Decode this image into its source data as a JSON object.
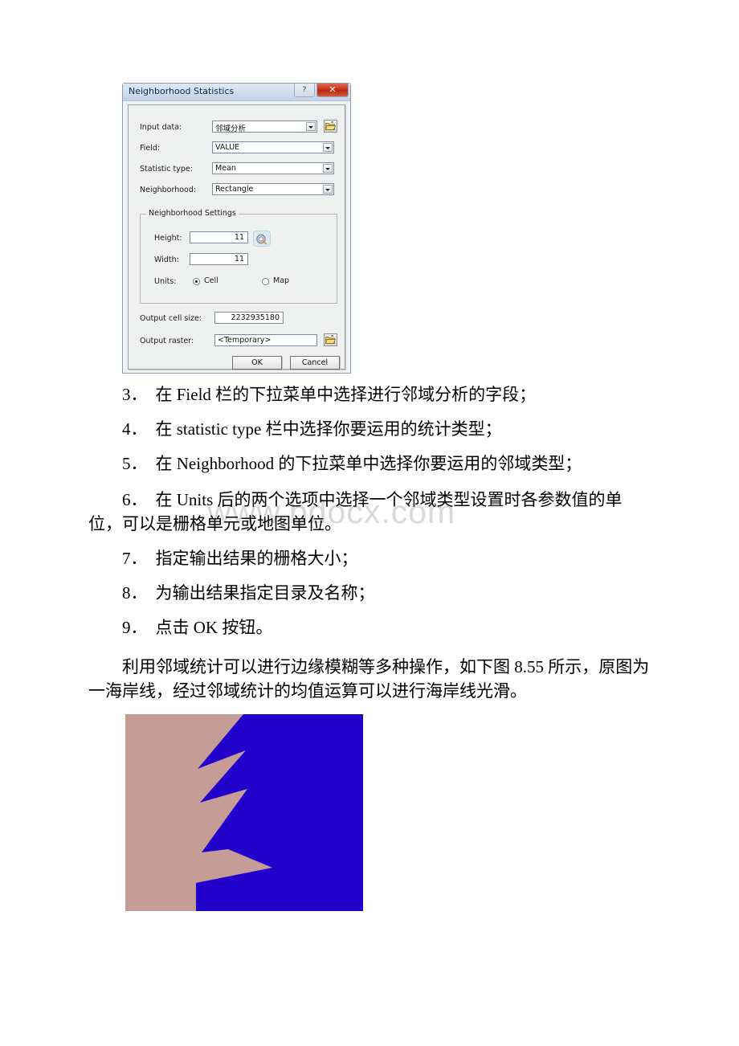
{
  "document": {
    "page_background": "#ffffff",
    "watermark": "www.bdocx.com",
    "watermark_color": "#d9d9d9"
  },
  "dialog": {
    "title": "Neighborhood Statistics",
    "help_button": "?",
    "close_button": "✕",
    "close_button_color": "#c8331b",
    "fields": [
      {
        "label": "Input data:",
        "value": "邻域分析",
        "type": "combobox",
        "has_browse": true
      },
      {
        "label": "Field:",
        "value": "VALUE",
        "type": "combobox",
        "has_browse": false
      },
      {
        "label": "Statistic type:",
        "value": "Mean",
        "type": "combobox",
        "has_browse": false
      },
      {
        "label": "Neighborhood:",
        "value": "Rectangle",
        "type": "combobox",
        "has_browse": false
      }
    ],
    "group": {
      "title": "Neighborhood Settings",
      "height_label": "Height:",
      "height_value": "11",
      "width_label": "Width:",
      "width_value": "11",
      "units_label": "Units:",
      "unit_options": [
        {
          "label": "Cell",
          "selected": true
        },
        {
          "label": "Map",
          "selected": false
        }
      ]
    },
    "output_cell_size_label": "Output cell size:",
    "output_cell_size_value": "2232935180",
    "output_raster_label": "Output raster:",
    "output_raster_value": "<Temporary>",
    "ok_label": "OK",
    "cancel_label": "Cancel"
  },
  "body": {
    "items": [
      {
        "num": "3．",
        "text": "在 Field 栏的下拉菜单中选择进行邻域分析的字段；"
      },
      {
        "num": "4．",
        "text": "在 statistic type 栏中选择你要运用的统计类型；"
      },
      {
        "num": "5．",
        "text": "在 Neighborhood 的下拉菜单中选择你要运用的邻域类型；"
      },
      {
        "num": "6．",
        "text": "在 Units 后的两个选项中选择一个邻域类型设置时各参数值的单位，可以是栅格单元或地图单位。"
      },
      {
        "num": "7．",
        "text": "指定输出结果的栅格大小；"
      },
      {
        "num": "8．",
        "text": "为输出结果指定目录及名称；"
      },
      {
        "num": "9．",
        "text": "点击 OK 按钮。"
      }
    ],
    "closing_paragraph": "利用邻域统计可以进行边缘模糊等多种操作，如下图 8.55 所示，原图为一海岸线，经过邻域统计的均值运算可以进行海岸线光滑。"
  },
  "figure": {
    "caption_reference": "图 8.55",
    "land_color": "#c69c97",
    "sea_color": "#2200cc",
    "description": "coastline raster: land on left, sea on right with jagged inlets"
  }
}
